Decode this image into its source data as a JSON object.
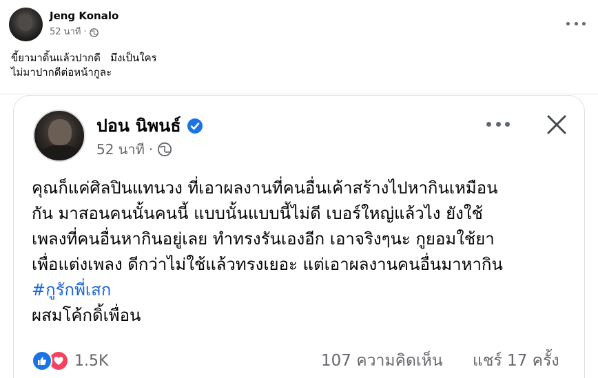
{
  "outer_post": {
    "author": "Jeng Konalo",
    "time": "52 นาที",
    "separator": "·",
    "privacy_icon": "globe-icon",
    "text_lines": [
      "ขี้ยามาดิ้นแล้วปากดี   มึงเป็นใคร",
      "ไม่มาปากดีต่อหน้ากูละ"
    ]
  },
  "shared_card": {
    "author": "ปอน นิพนธ์",
    "verified_icon": "verified-badge-icon",
    "time": "52 นาที",
    "separator": "·",
    "privacy_icon": "globe-icon",
    "body_lines": [
      "คุณก็แค่ศิลปินแทนวง ที่เอาผลงานที่คนอื่นเค้าสร้างไปหากินเหมือน",
      "กัน มาสอนคนนั้นคนนี้ แบบนั้นแบบนี้ไม่ดี เบอร์ใหญ่แล้วไง ยังใช้",
      "เพลงที่คนอื่นหากินอยู่เลย ทำทรงรันเองอีก เอาจริงๆนะ กูยอมใช้ยา",
      "เพื่อแต่งเพลง ดีกว่าไม่ใช้แล้วทรงเยอะ แต่เอาผลงานคนอื่นมาหากิน"
    ],
    "hashtag": "#กูรักพี่เสก",
    "last_line": "ผสมโค้กดิ้เพื่อน",
    "reactions": {
      "icons": [
        "like-icon",
        "love-icon"
      ],
      "count": "1.5K"
    },
    "comments": "107 ความคิดเห็น",
    "shares": "แชร์ 17 ครั้ง"
  },
  "colors": {
    "meta_gray": "#65676b",
    "hashtag_blue": "#1a66d6",
    "like_blue": "#1b74e4",
    "love_red": "#f3425f"
  }
}
